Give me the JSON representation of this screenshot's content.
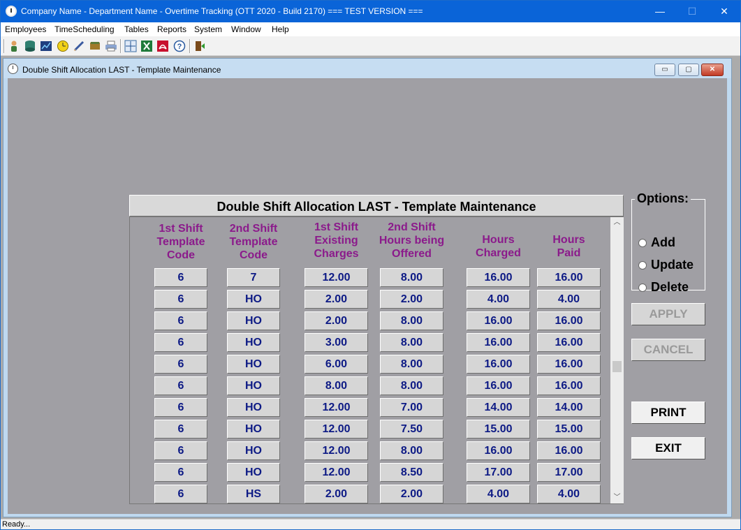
{
  "window": {
    "title": "Company Name - Department Name - Overtime Tracking (OTT 2020 - Build 2170)  === TEST VERSION ===",
    "min_glyph": "—",
    "max_glyph": "☐",
    "close_glyph": "✕"
  },
  "menu": {
    "items": [
      "Employees",
      "TimeScheduling",
      "Tables",
      "Reports",
      "System",
      "Window",
      "Help"
    ]
  },
  "toolbar": {
    "icons": [
      "person-icon",
      "database-icon",
      "chart-icon",
      "clock-icon",
      "pencil-icon",
      "book-icon",
      "printer-icon",
      "crosshair-icon",
      "excel-icon",
      "acrobat-icon",
      "help-icon",
      "exit-door-icon"
    ]
  },
  "child": {
    "title": "Double Shift Allocation LAST - Template Maintenance",
    "min_glyph": "▭",
    "max_glyph": "▢",
    "close_glyph": "✕"
  },
  "form": {
    "header": "Double Shift Allocation LAST - Template Maintenance",
    "columns": [
      "1st Shift Template Code",
      "2nd Shift Template Code",
      "1st Shift Existing Charges",
      "2nd Shift Hours being Offered",
      "Hours Charged",
      "Hours Paid"
    ],
    "column_lines": [
      [
        "1st Shift",
        "Template",
        "Code"
      ],
      [
        "2nd Shift",
        "Template",
        "Code"
      ],
      [
        "1st Shift",
        "Existing",
        "Charges"
      ],
      [
        "2nd Shift",
        "Hours being",
        "Offered"
      ],
      [
        "Hours",
        "Charged"
      ],
      [
        "Hours",
        "Paid"
      ]
    ],
    "rows": [
      [
        "6",
        "7",
        "12.00",
        "8.00",
        "16.00",
        "16.00"
      ],
      [
        "6",
        "HO",
        "2.00",
        "2.00",
        "4.00",
        "4.00"
      ],
      [
        "6",
        "HO",
        "2.00",
        "8.00",
        "16.00",
        "16.00"
      ],
      [
        "6",
        "HO",
        "3.00",
        "8.00",
        "16.00",
        "16.00"
      ],
      [
        "6",
        "HO",
        "6.00",
        "8.00",
        "16.00",
        "16.00"
      ],
      [
        "6",
        "HO",
        "8.00",
        "8.00",
        "16.00",
        "16.00"
      ],
      [
        "6",
        "HO",
        "12.00",
        "7.00",
        "14.00",
        "14.00"
      ],
      [
        "6",
        "HO",
        "12.00",
        "7.50",
        "15.00",
        "15.00"
      ],
      [
        "6",
        "HO",
        "12.00",
        "8.00",
        "16.00",
        "16.00"
      ],
      [
        "6",
        "HO",
        "12.00",
        "8.50",
        "17.00",
        "17.00"
      ],
      [
        "6",
        "HS",
        "2.00",
        "2.00",
        "4.00",
        "4.00"
      ]
    ],
    "scroll_up_glyph": "︿",
    "scroll_down_glyph": "﹀"
  },
  "options": {
    "legend": "Options:",
    "choices": [
      "Add",
      "Update",
      "Delete"
    ]
  },
  "buttons": {
    "apply": "APPLY",
    "cancel": "CANCEL",
    "print": "PRINT",
    "exit": "EXIT"
  },
  "colors": {
    "header_text": "#8b1a8b",
    "cell_text": "#0d1a85",
    "form_bg": "#a09fa4",
    "titlebar": "#0a64d8"
  },
  "status": {
    "text": "Ready..."
  }
}
